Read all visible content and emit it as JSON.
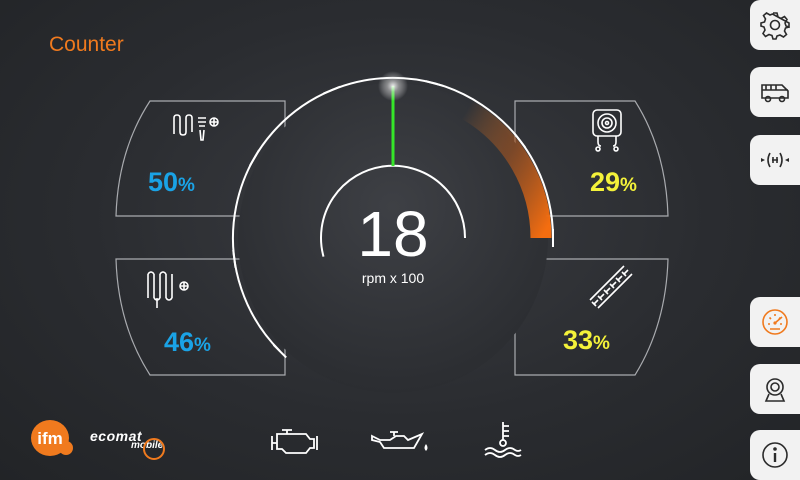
{
  "screen": {
    "title": "Counter"
  },
  "gauge": {
    "value": "18",
    "unit": "rpm x 100",
    "max": 30,
    "warning_from": 22,
    "colors": {
      "warning": "#f07a1e",
      "needle": "#35e629"
    }
  },
  "panels": {
    "top_left": {
      "icon": "hose-reel-icon",
      "value": "50",
      "unit": "%",
      "color": "#1aa3e6"
    },
    "bottom_left": {
      "icon": "hose-heater-icon",
      "value": "46",
      "unit": "%",
      "color": "#1aa3e6"
    },
    "top_right": {
      "icon": "cable-reel-icon",
      "value": "29",
      "unit": "%",
      "color": "#f4f23a"
    },
    "bottom_right": {
      "icon": "ladder-icon",
      "value": "33",
      "unit": "%",
      "color": "#f4f23a"
    }
  },
  "status_icons": [
    "engine-warning-icon",
    "oil-pressure-icon",
    "coolant-temperature-icon"
  ],
  "brand": {
    "logo_text": "ifm",
    "product_line": "ecomat",
    "product_sub": "mobile",
    "logo_color": "#f07a1e"
  },
  "sidebar": {
    "items": [
      {
        "icon": "settings-gear-icon",
        "active": false
      },
      {
        "icon": "vehicle-icon",
        "active": false
      },
      {
        "icon": "axle-icon",
        "active": false
      },
      {
        "icon": "speedometer-icon",
        "active": true
      },
      {
        "icon": "camera-icon",
        "active": false
      },
      {
        "icon": "info-icon",
        "active": false
      }
    ]
  }
}
